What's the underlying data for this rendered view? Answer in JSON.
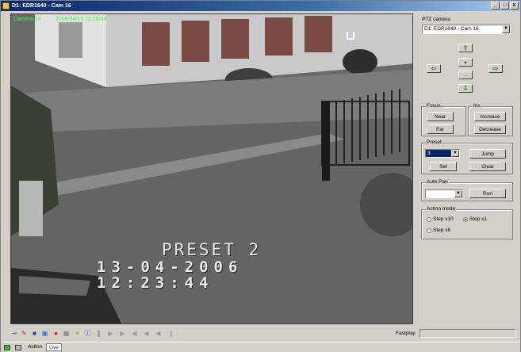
{
  "window": {
    "title": "D1: EDR1640 - Cam 16",
    "min": "_",
    "max": "□",
    "close": "x"
  },
  "video": {
    "camera_label": "Camera 16",
    "camera_time": "2006/04/13 12:23:44",
    "preset_text": "PRESET 2",
    "date_text": "13-04-2006",
    "time_text": "12:23:44"
  },
  "panel": {
    "ptz_title": "PTZ camera",
    "camera_select": "D1: EDR1640 - Cam 16",
    "zoom_in": "+",
    "zoom_out": "-",
    "focus": {
      "title": "Focus",
      "near": "Near",
      "far": "Far"
    },
    "iris": {
      "title": "Iris",
      "increase": "Increase",
      "decrease": "Decrease"
    },
    "preset": {
      "title": "Preset",
      "value": "3",
      "jump": "Jump",
      "set": "Set",
      "clear": "Clear"
    },
    "autopan": {
      "title": "Auto Pan",
      "value": "",
      "run": "Run"
    },
    "action_mode": {
      "title": "Action mode",
      "opt1": "Step x10",
      "opt2": "Step x1",
      "opt3": "Step x5",
      "selected": "Step x1"
    }
  },
  "toolbar": {
    "fastplay": "Fastplay"
  },
  "status": {
    "action": "Action",
    "live": "Live"
  },
  "colors": {
    "title_start": "#0a246a",
    "osd_green": "#3cff3c",
    "arrow_green": "#2a8a2a"
  }
}
